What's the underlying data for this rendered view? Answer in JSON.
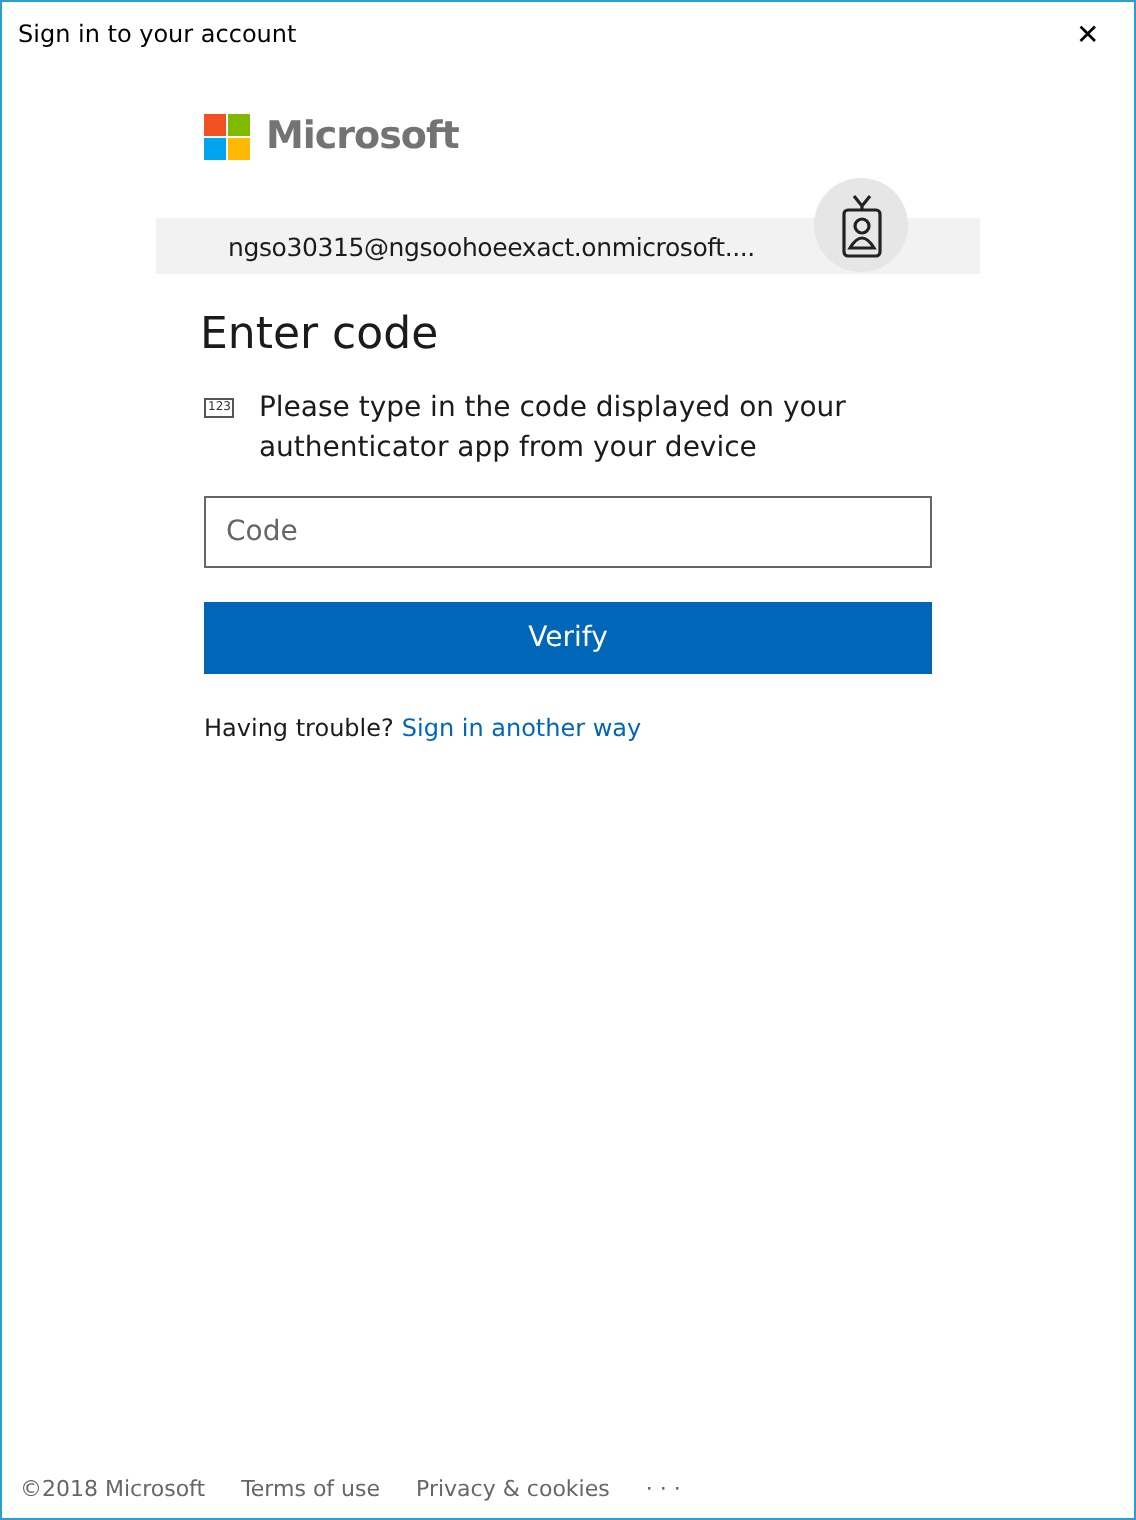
{
  "window": {
    "title": "Sign in to your account",
    "close": "✕"
  },
  "brand": {
    "name": "Microsoft"
  },
  "account": {
    "email": "ngso30315@ngsoohoeexact.onmicrosoft...."
  },
  "heading": "Enter code",
  "instruction": {
    "icon_text": "123",
    "text": "Please type in the code displayed on your authenticator app from your device"
  },
  "code_field": {
    "placeholder": "Code"
  },
  "verify_button": "Verify",
  "trouble": {
    "text": "Having trouble?",
    "link": "Sign in another way"
  },
  "footer": [
    "©2018 Microsoft",
    "Terms of use",
    "Privacy & cookies",
    "· · ·"
  ]
}
